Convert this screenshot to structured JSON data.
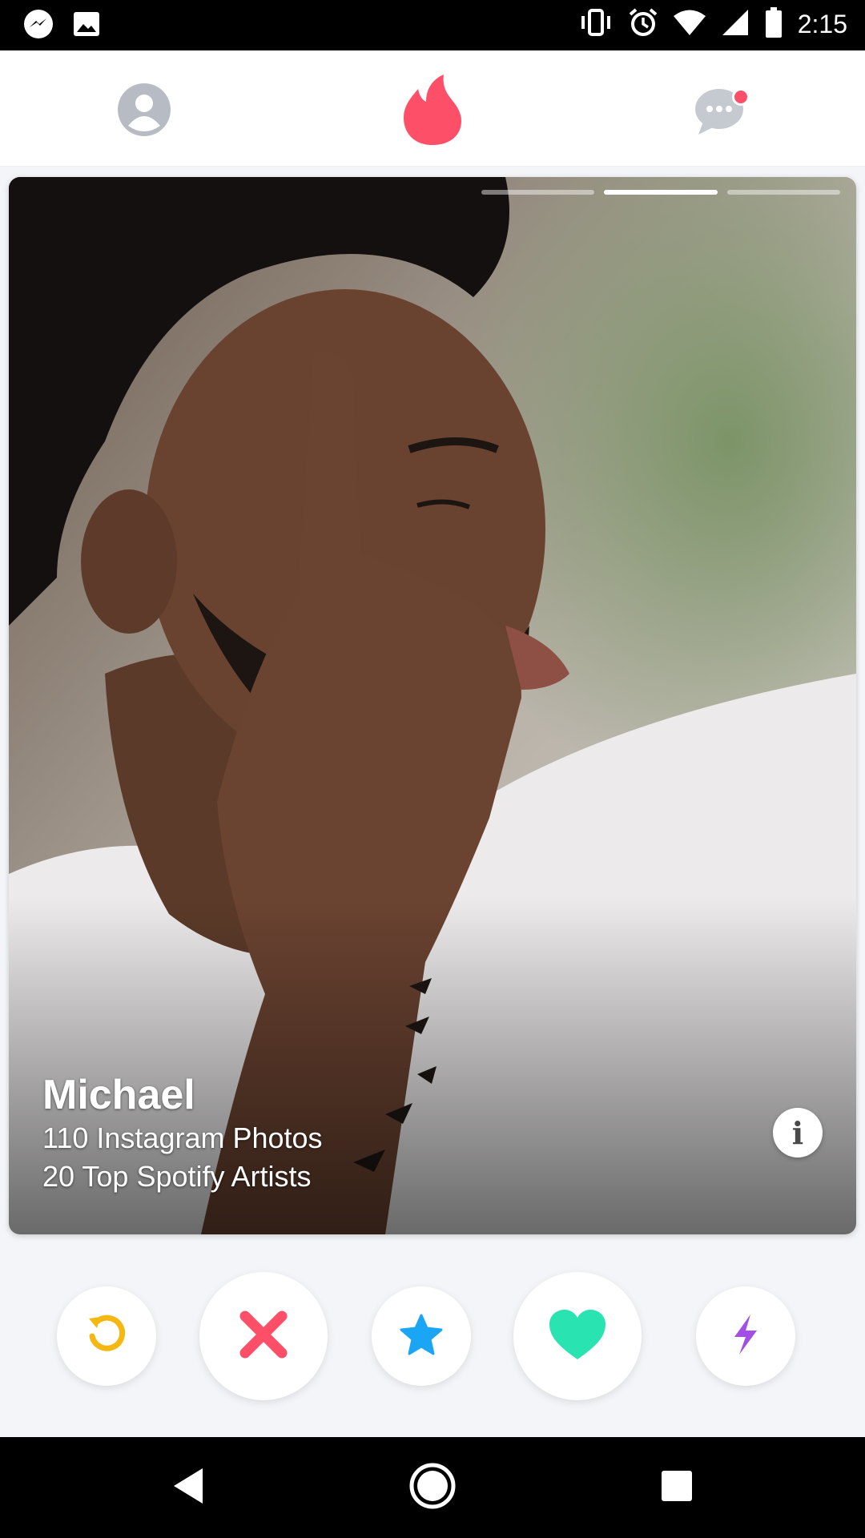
{
  "status_bar": {
    "time": "2:15",
    "left_icons": [
      "messenger-icon",
      "gallery-icon"
    ],
    "right_icons": [
      "vibrate-icon",
      "alarm-icon",
      "wifi-icon",
      "signal-icon",
      "battery-icon"
    ]
  },
  "top_nav": {
    "profile_icon": "person-icon",
    "home_icon": "flame-icon",
    "messages_icon": "chat-icon",
    "messages_has_notification": true,
    "accent_color": "#fd5068"
  },
  "card": {
    "name": "Michael",
    "lines": [
      "110 Instagram Photos",
      "20 Top Spotify Artists"
    ],
    "photo_count": 3,
    "active_photo_index": 1,
    "info_label": "i"
  },
  "actions": [
    {
      "name": "rewind",
      "icon": "rewind-icon",
      "color": "#f5b813"
    },
    {
      "name": "nope",
      "icon": "close-icon",
      "color": "#fd5068"
    },
    {
      "name": "super-like",
      "icon": "star-icon",
      "color": "#1ba5f5"
    },
    {
      "name": "like",
      "icon": "heart-icon",
      "color": "#29e3b0"
    },
    {
      "name": "boost",
      "icon": "lightning-icon",
      "color": "#a24ee7"
    }
  ],
  "nav_bar": {
    "back_icon": "back-icon",
    "home_icon": "home-icon",
    "recents_icon": "recents-icon"
  }
}
